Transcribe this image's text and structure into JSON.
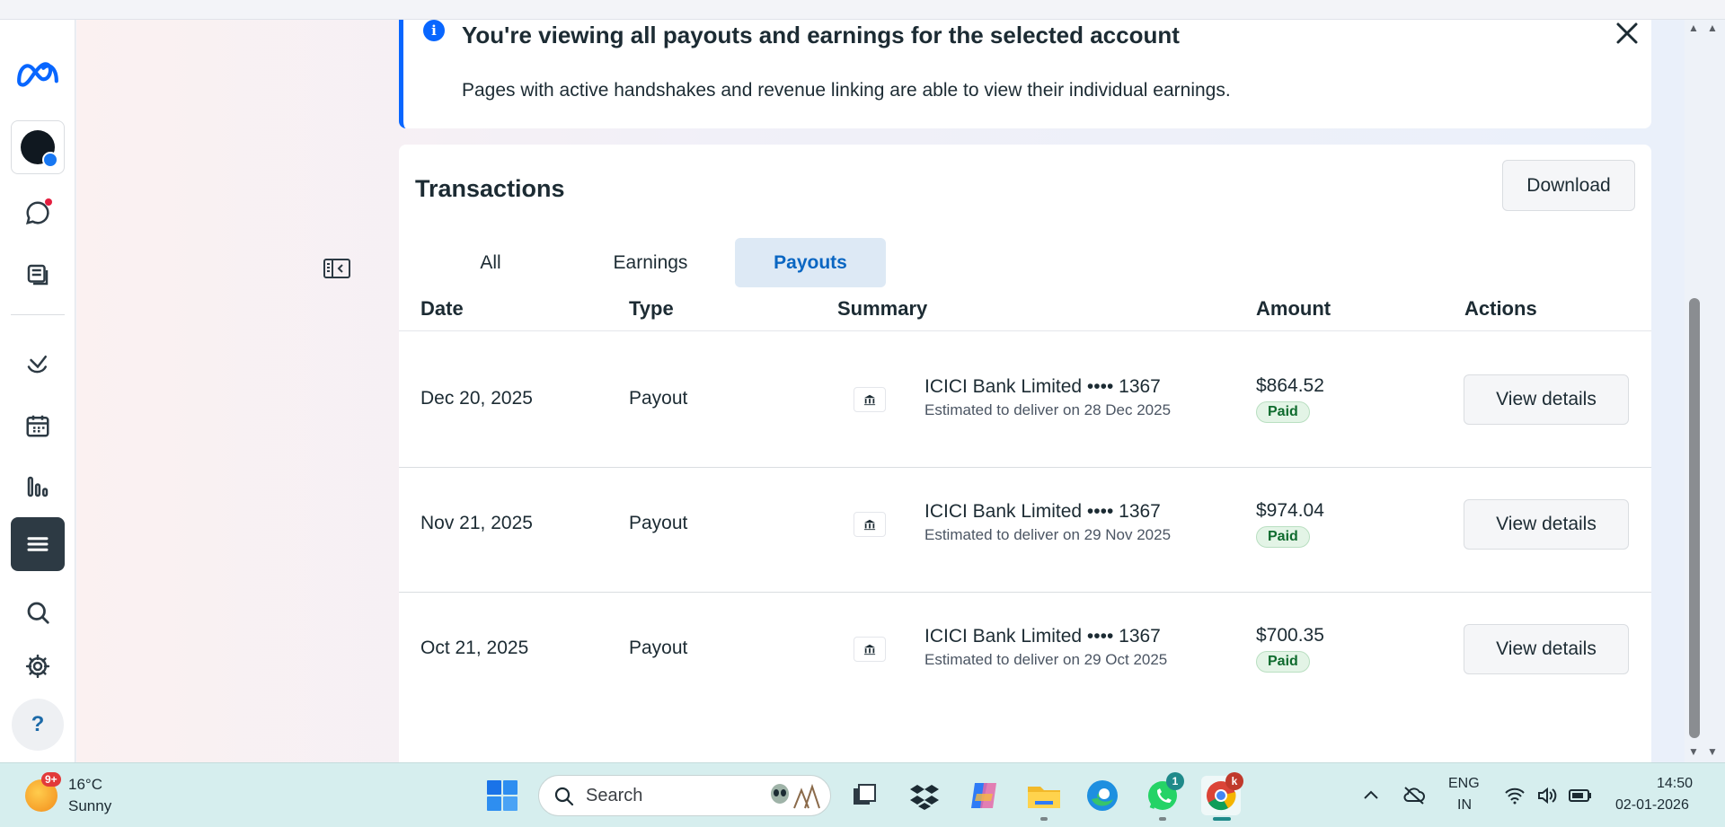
{
  "banner": {
    "title": "You're viewing all payouts and earnings for the selected account",
    "text": "Pages with active handshakes and revenue linking are able to view their individual earnings."
  },
  "transactions": {
    "title": "Transactions",
    "download_label": "Download",
    "tabs": [
      {
        "label": "All",
        "active": false
      },
      {
        "label": "Earnings",
        "active": false
      },
      {
        "label": "Payouts",
        "active": true
      }
    ],
    "columns": [
      "Date",
      "Type",
      "Summary",
      "Amount",
      "Actions"
    ],
    "rows": [
      {
        "date": "Dec 20, 2025",
        "type": "Payout",
        "bank": "ICICI Bank Limited •••• 1367",
        "delivery": "Estimated to deliver on 28 Dec 2025",
        "amount": "$864.52",
        "status": "Paid",
        "action": "View details"
      },
      {
        "date": "Nov 21, 2025",
        "type": "Payout",
        "bank": "ICICI Bank Limited •••• 1367",
        "delivery": "Estimated to deliver on 29 Nov 2025",
        "amount": "$974.04",
        "status": "Paid",
        "action": "View details"
      },
      {
        "date": "Oct 21, 2025",
        "type": "Payout",
        "bank": "ICICI Bank Limited •••• 1367",
        "delivery": "Estimated to deliver on 29 Oct 2025",
        "amount": "$700.35",
        "status": "Paid",
        "action": "View details"
      }
    ]
  },
  "rail": {
    "help_label": "?"
  },
  "taskbar": {
    "weather_badge": "9+",
    "temperature": "16°C",
    "condition": "Sunny",
    "search_placeholder": "Search",
    "whatsapp_badge": "1",
    "chrome_badge": "k",
    "language_top": "ENG",
    "language_bottom": "IN",
    "time": "14:50",
    "date": "02-01-2026"
  },
  "colors": {
    "accent": "#0866ff",
    "tab_active_bg": "#dde9f5",
    "paid_bg": "#e3f4e6",
    "rail_active": "#2d3a44"
  }
}
